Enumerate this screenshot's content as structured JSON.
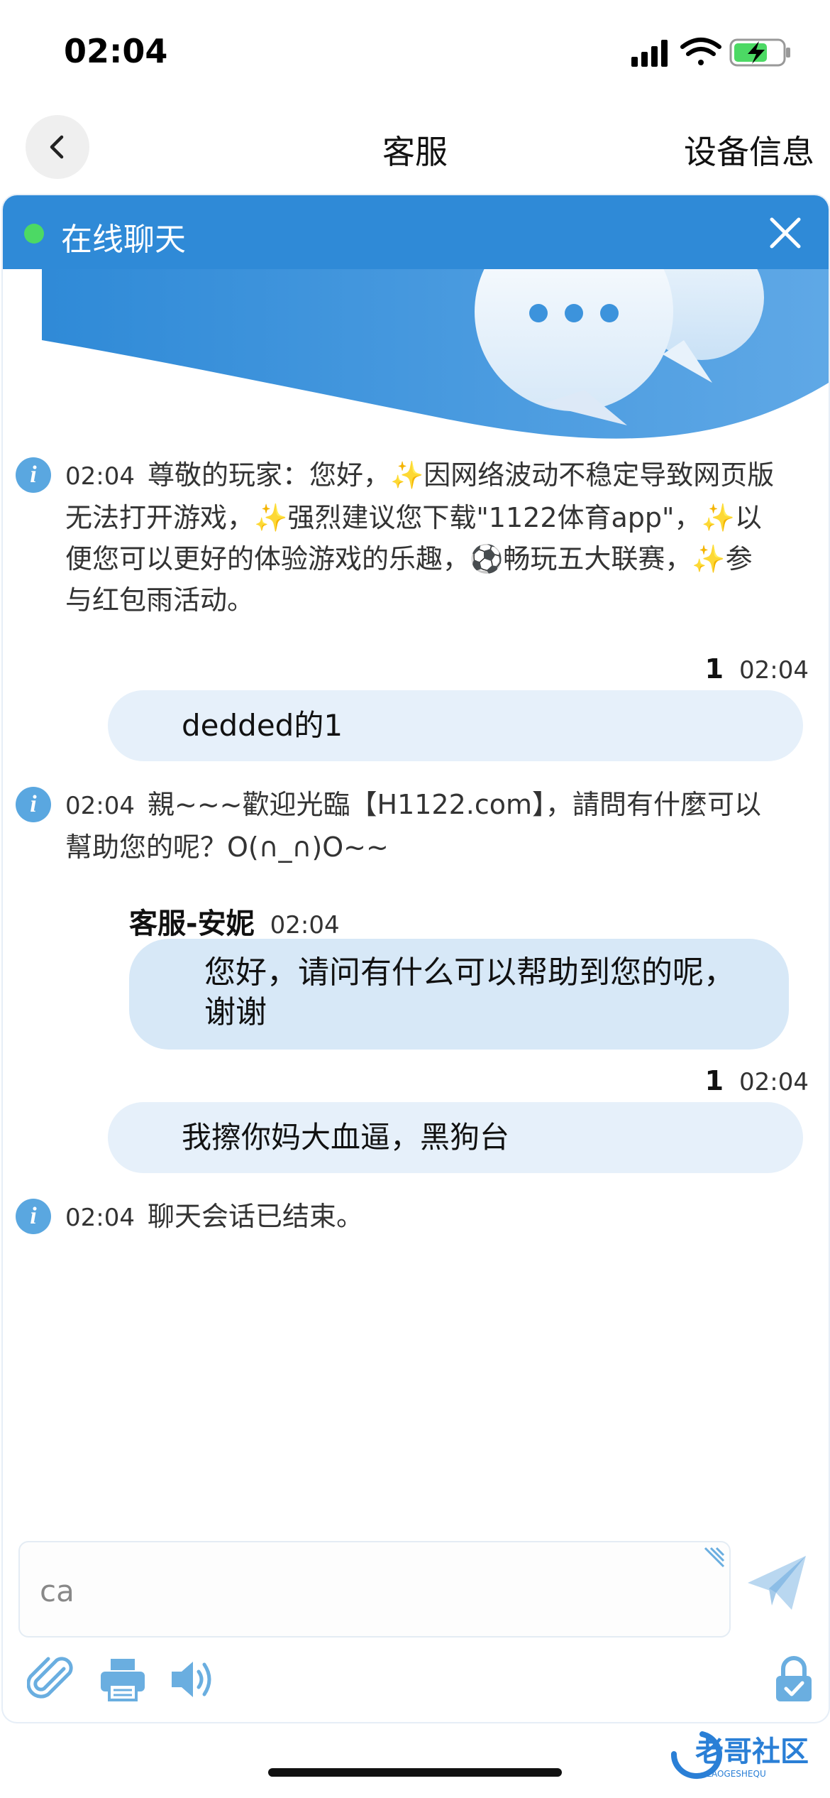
{
  "status_bar": {
    "time": "02:04"
  },
  "nav": {
    "title": "客服",
    "right_label": "设备信息"
  },
  "chat": {
    "title": "在线聊天",
    "messages": [
      {
        "type": "system",
        "time": "02:04",
        "text": "尊敬的玩家：您好，✨因网络波动不稳定导致网页版无法打开游戏，✨强烈建议您下载\"1122体育app\"，✨以便您可以更好的体验游戏的乐趣，⚽畅玩五大联赛，✨参与红包雨活动。"
      },
      {
        "type": "user",
        "sender": "1",
        "time": "02:04",
        "text": "dedded的1"
      },
      {
        "type": "system",
        "time": "02:04",
        "text": "親~~~歡迎光臨【H1122.com】，請問有什麼可以幫助您的呢？O(∩_∩)O~~"
      },
      {
        "type": "agent",
        "sender": "客服-安妮",
        "time": "02:04",
        "text": "您好，请问有什么可以帮助到您的呢，谢谢"
      },
      {
        "type": "user",
        "sender": "1",
        "time": "02:04",
        "text": "我擦你妈大血逼，黑狗台"
      },
      {
        "type": "system",
        "time": "02:04",
        "text": "聊天会话已结束。"
      }
    ]
  },
  "input": {
    "value": "ca",
    "placeholder": ""
  },
  "icons": {
    "back": "chevron-left-icon",
    "close": "close-icon",
    "info": "info-icon",
    "send": "paper-plane-icon",
    "attach": "paperclip-icon",
    "print": "printer-icon",
    "sound": "speaker-icon",
    "lock": "lock-icon"
  },
  "colors": {
    "header": "#2f8ad7",
    "online": "#4cd964",
    "user_bubble": "#e6f0fa",
    "agent_bubble": "#d7e8f7",
    "icon": "#6aaee0"
  },
  "watermark": {
    "title": "老哥社区",
    "subtitle": "LAOGESHEQU"
  }
}
